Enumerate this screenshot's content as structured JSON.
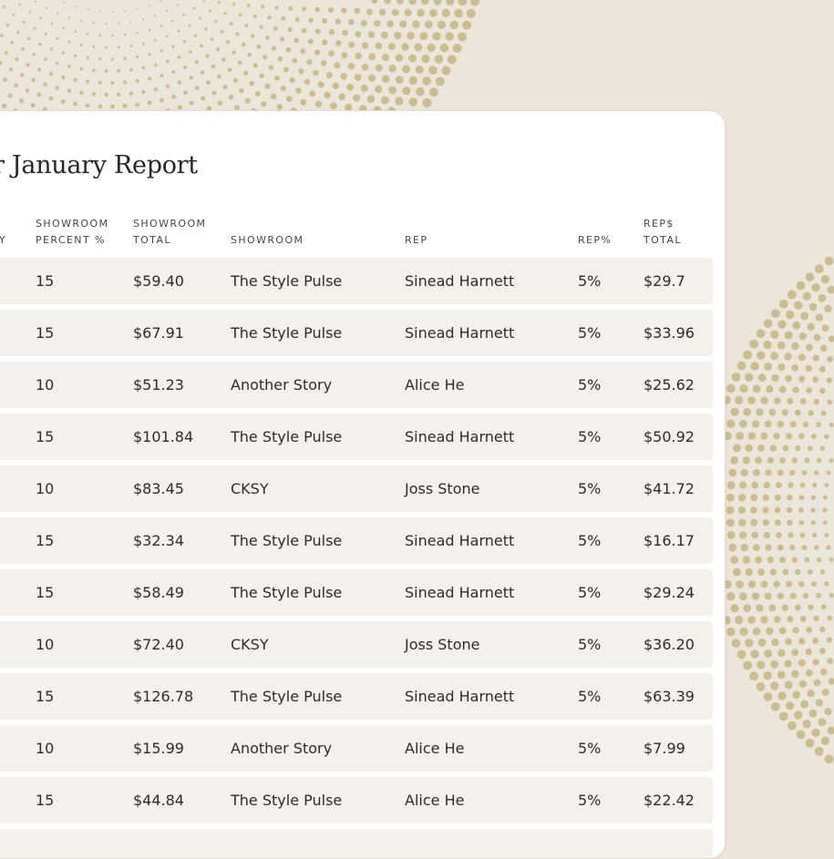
{
  "report": {
    "title": "r January Report",
    "cut_header_fragment": "Y",
    "columns": [
      {
        "line1": "SHOWROOM",
        "line2": "PERCENT %"
      },
      {
        "line1": "SHOWROOM",
        "line2": "TOTAL"
      },
      {
        "line1": "",
        "line2": "SHOWROOM"
      },
      {
        "line1": "",
        "line2": "REP"
      },
      {
        "line1": "",
        "line2": "REP%"
      },
      {
        "line1": "REP$",
        "line2": "TOTAL"
      }
    ],
    "rows": [
      {
        "showroom_percent": "15",
        "showroom_total": "$59.40",
        "showroom": "The Style Pulse",
        "rep": "Sinead Harnett",
        "rep_percent": "5%",
        "rep_total": "$29.7"
      },
      {
        "showroom_percent": "15",
        "showroom_total": "$67.91",
        "showroom": "The Style Pulse",
        "rep": "Sinead Harnett",
        "rep_percent": "5%",
        "rep_total": "$33.96"
      },
      {
        "showroom_percent": "10",
        "showroom_total": "$51.23",
        "showroom": "Another Story",
        "rep": "Alice He",
        "rep_percent": "5%",
        "rep_total": "$25.62"
      },
      {
        "showroom_percent": "15",
        "showroom_total": "$101.84",
        "showroom": "The Style Pulse",
        "rep": "Sinead Harnett",
        "rep_percent": "5%",
        "rep_total": "$50.92"
      },
      {
        "showroom_percent": "10",
        "showroom_total": "$83.45",
        "showroom": "CKSY",
        "rep": "Joss Stone",
        "rep_percent": "5%",
        "rep_total": "$41.72"
      },
      {
        "showroom_percent": "15",
        "showroom_total": "$32.34",
        "showroom": "The Style Pulse",
        "rep": "Sinead Harnett",
        "rep_percent": "5%",
        "rep_total": "$16.17"
      },
      {
        "showroom_percent": "15",
        "showroom_total": "$58.49",
        "showroom": "The Style Pulse",
        "rep": "Sinead Harnett",
        "rep_percent": "5%",
        "rep_total": "$29.24"
      },
      {
        "showroom_percent": "10",
        "showroom_total": "$72.40",
        "showroom": "CKSY",
        "rep": "Joss Stone",
        "rep_percent": "5%",
        "rep_total": "$36.20"
      },
      {
        "showroom_percent": "15",
        "showroom_total": "$126.78",
        "showroom": "The Style Pulse",
        "rep": "Sinead Harnett",
        "rep_percent": "5%",
        "rep_total": "$63.39"
      },
      {
        "showroom_percent": "10",
        "showroom_total": "$15.99",
        "showroom": "Another Story",
        "rep": "Alice He",
        "rep_percent": "5%",
        "rep_total": "$7.99"
      },
      {
        "showroom_percent": "15",
        "showroom_total": "$44.84",
        "showroom": "The Style Pulse",
        "rep": "Alice He",
        "rep_percent": "5%",
        "rep_total": "$22.42"
      }
    ]
  },
  "colors": {
    "background": "#ece5da",
    "dots": "#cbbd92",
    "card": "#ffffff",
    "row": "#f4f1ec",
    "text": "#2f2b27"
  }
}
